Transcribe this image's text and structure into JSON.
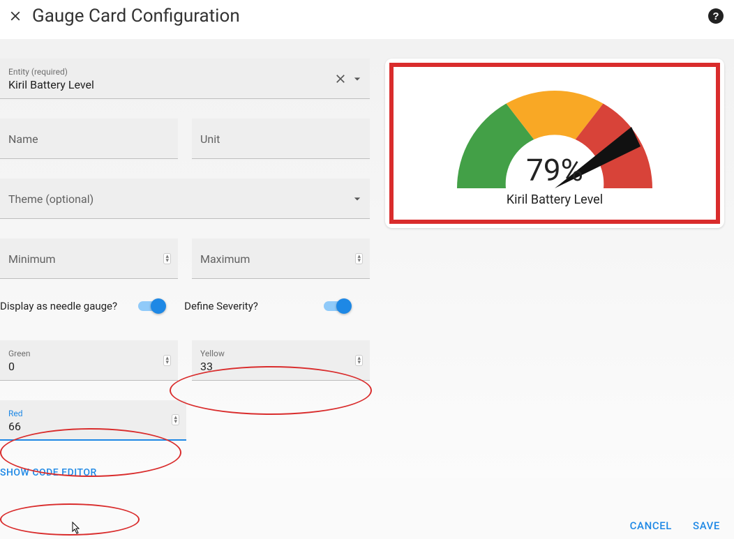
{
  "header": {
    "title": "Gauge Card Configuration"
  },
  "entity": {
    "label": "Entity (required)",
    "value": "Kiril Battery Level"
  },
  "name": {
    "label": "Name",
    "value": ""
  },
  "unit": {
    "label": "Unit",
    "value": ""
  },
  "theme": {
    "label": "Theme (optional)",
    "value": ""
  },
  "minimum": {
    "label": "Minimum",
    "value": ""
  },
  "maximum": {
    "label": "Maximum",
    "value": ""
  },
  "needle_toggle": {
    "label": "Display as needle gauge?",
    "on": true
  },
  "severity_toggle": {
    "label": "Define Severity?",
    "on": true
  },
  "severity": {
    "green": {
      "label": "Green",
      "value": "0"
    },
    "yellow": {
      "label": "Yellow",
      "value": "33"
    },
    "red": {
      "label": "Red",
      "value": "66"
    }
  },
  "code_link": "SHOW CODE EDITOR",
  "footer": {
    "cancel": "CANCEL",
    "save": "SAVE"
  },
  "preview": {
    "value_text": "79%",
    "caption": "Kiril Battery Level"
  },
  "chart_data": {
    "type": "gauge",
    "value": 79,
    "unit": "%",
    "min": 0,
    "max": 100,
    "needle": true,
    "severity": [
      {
        "name": "green",
        "from": 0,
        "color": "#43a047"
      },
      {
        "name": "yellow",
        "from": 33,
        "color": "#f9a825"
      },
      {
        "name": "red",
        "from": 66,
        "color": "#d84339"
      }
    ],
    "title": "Kiril Battery Level"
  }
}
